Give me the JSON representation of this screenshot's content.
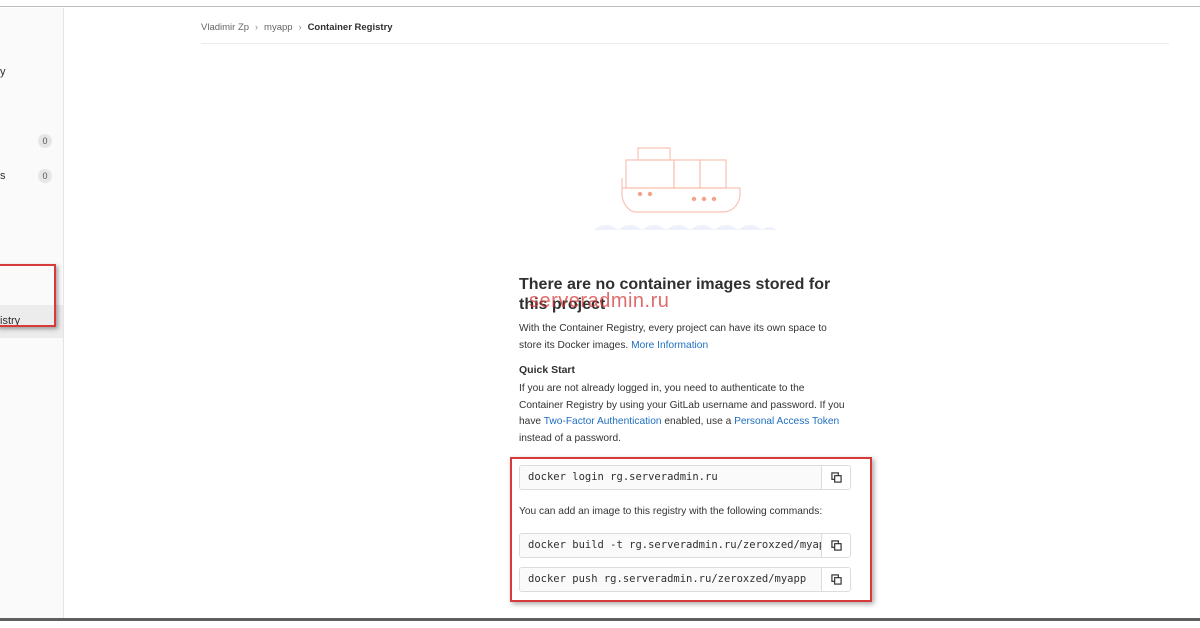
{
  "sidebar": {
    "fragments": [
      {
        "text": "y"
      },
      {
        "text": "s"
      }
    ],
    "badges": [
      "0",
      "0"
    ],
    "active_item": "istry"
  },
  "breadcrumb": {
    "items": [
      "Vladimir Zp",
      "myapp"
    ],
    "current": "Container Registry"
  },
  "empty_state": {
    "title": "There are no container images stored for this project",
    "intro": "With the Container Registry, every project can have its own space to store its Docker images.",
    "intro_link": "More Information",
    "quick_start_heading": "Quick Start",
    "auth_text_1": "If you are not already logged in, you need to authenticate to the Container Registry by using your GitLab username and password. If you have",
    "auth_link_1": "Two-Factor Authentication",
    "auth_text_2": "enabled, use a",
    "auth_link_2": "Personal Access Token",
    "auth_text_3": "instead of a password.",
    "add_image_text": "You can add an image to this registry with the following commands:"
  },
  "commands": {
    "login": "docker login rg.serveradmin.ru",
    "build": "docker build -t rg.serveradmin.ru/zeroxzed/myapp .",
    "push": "docker push rg.serveradmin.ru/zeroxzed/myapp"
  },
  "watermark": "serveradmin.ru",
  "colors": {
    "accent_link": "#1f6fbf",
    "highlight": "#d63a3a",
    "illustration": "#f6a38b"
  },
  "icons": {
    "copy": "copy-icon",
    "chevron": "chevron-right-icon"
  }
}
